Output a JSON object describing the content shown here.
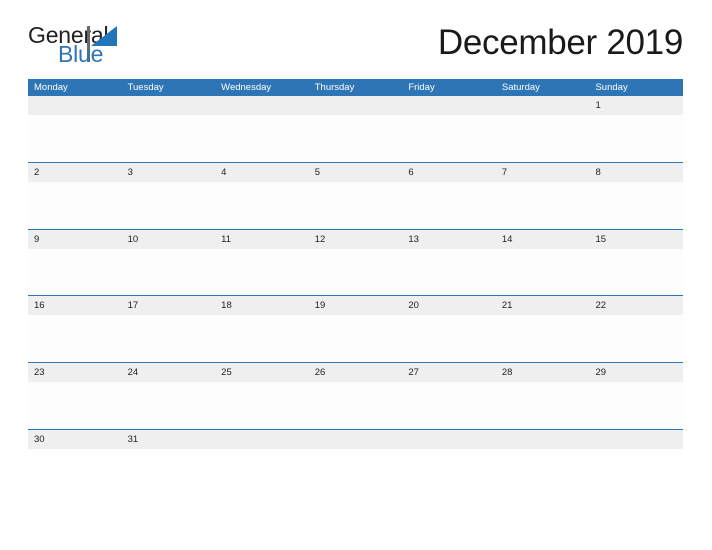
{
  "brand": {
    "name_part1": "General",
    "name_part2": "Blue",
    "primary_color": "#2e75b6",
    "triangle_color": "#2175ba"
  },
  "header": {
    "title": "December 2019"
  },
  "calendar": {
    "weekdays": [
      "Monday",
      "Tuesday",
      "Wednesday",
      "Thursday",
      "Friday",
      "Saturday",
      "Sunday"
    ],
    "header_bg": "#2e75b6",
    "band_bg": "#efefef",
    "rule_color": "#2e75b6",
    "weeks": [
      {
        "days": [
          "",
          "",
          "",
          "",
          "",
          "",
          "1"
        ]
      },
      {
        "days": [
          "2",
          "3",
          "4",
          "5",
          "6",
          "7",
          "8"
        ]
      },
      {
        "days": [
          "9",
          "10",
          "11",
          "12",
          "13",
          "14",
          "15"
        ]
      },
      {
        "days": [
          "16",
          "17",
          "18",
          "19",
          "20",
          "21",
          "22"
        ]
      },
      {
        "days": [
          "23",
          "24",
          "25",
          "26",
          "27",
          "28",
          "29"
        ]
      },
      {
        "days": [
          "30",
          "31",
          "",
          "",
          "",
          "",
          ""
        ]
      }
    ]
  }
}
